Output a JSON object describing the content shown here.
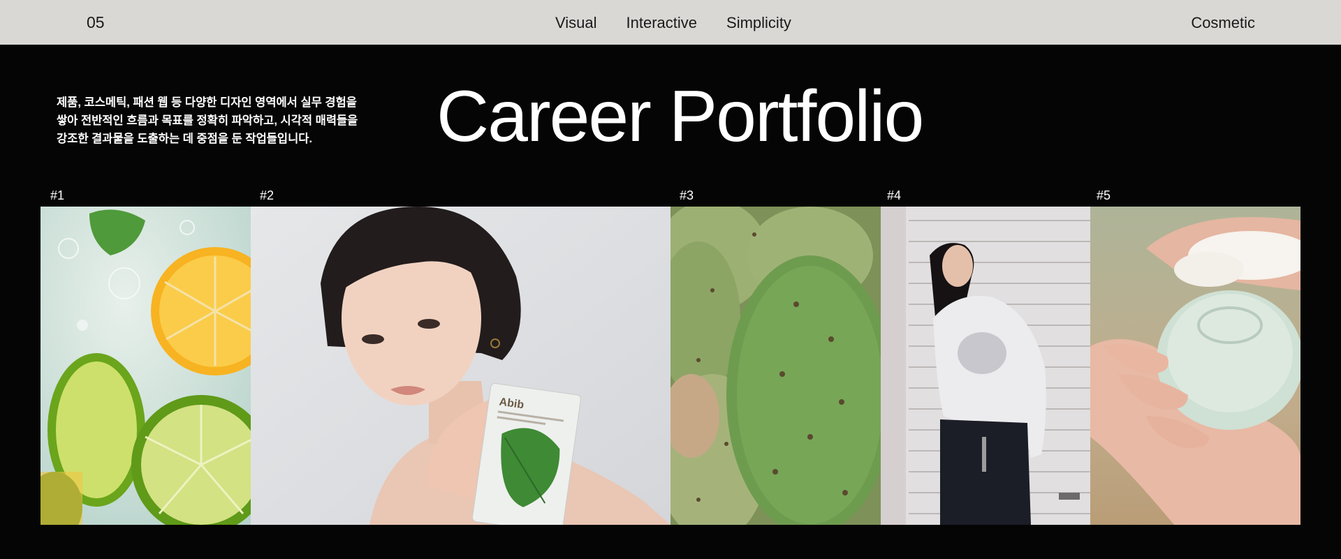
{
  "header": {
    "number": "05",
    "nav": [
      "Visual",
      "Interactive",
      "Simplicity"
    ],
    "right_label": "Cosmetic"
  },
  "intro": {
    "lines": [
      "제품, 코스메틱, 패션 웹 등 다양한 디자인 영역에서 실무 경험을",
      "쌓아 전반적인 흐름과 목표를 정확히 파악하고, 시각적 매력들을",
      "강조한 결과물을 도출하는 데 중점을 둔 작업들입니다."
    ]
  },
  "title": "Career Portfolio",
  "portfolio": [
    {
      "label": "#1",
      "image": "citrus-slices-image"
    },
    {
      "label": "#2",
      "image": "model-sheet-mask-image",
      "product_text": "Abib"
    },
    {
      "label": "#3",
      "image": "cactus-image"
    },
    {
      "label": "#4",
      "image": "fashion-model-image"
    },
    {
      "label": "#5",
      "image": "soap-bar-hand-image"
    }
  ],
  "colors": {
    "topbar_bg": "#d9d8d5",
    "page_bg": "#050505",
    "text_light": "#ffffff",
    "text_dark": "#1a1a1a"
  }
}
